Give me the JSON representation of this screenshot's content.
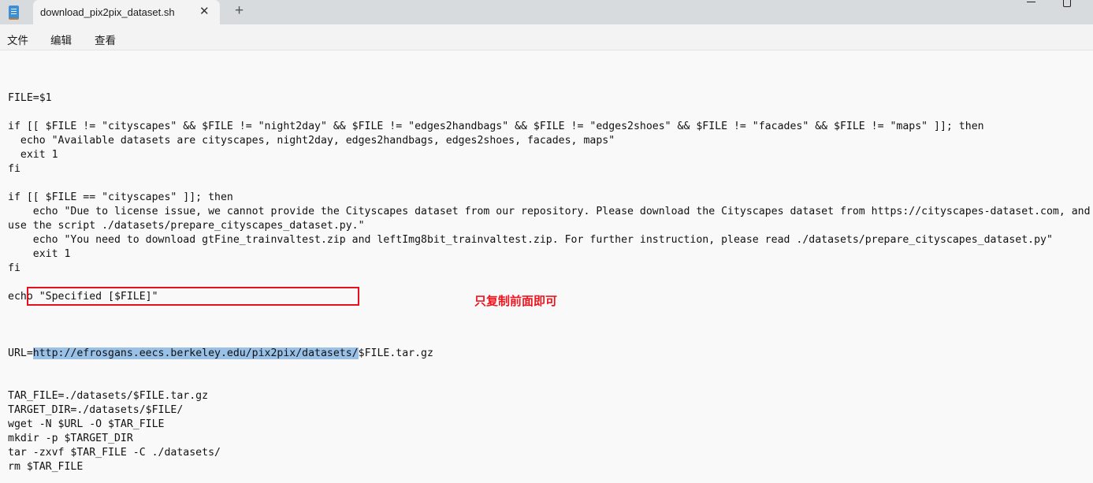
{
  "window": {
    "tab_title": "download_pix2pix_dataset.sh",
    "tab_close_icon": "close-icon",
    "new_tab_icon": "plus-icon",
    "new_tab_symbol": "+",
    "close_symbol": "✕"
  },
  "menu": {
    "items": [
      {
        "label": "文件"
      },
      {
        "label": "编辑"
      },
      {
        "label": "查看"
      }
    ]
  },
  "editor": {
    "lines": [
      "FILE=$1",
      "",
      "if [[ $FILE != \"cityscapes\" && $FILE != \"night2day\" && $FILE != \"edges2handbags\" && $FILE != \"edges2shoes\" && $FILE != \"facades\" && $FILE != \"maps\" ]]; then",
      "  echo \"Available datasets are cityscapes, night2day, edges2handbags, edges2shoes, facades, maps\"",
      "  exit 1",
      "fi",
      "",
      "if [[ $FILE == \"cityscapes\" ]]; then",
      "    echo \"Due to license issue, we cannot provide the Cityscapes dataset from our repository. Please download the Cityscapes dataset from https://cityscapes-dataset.com, and",
      "use the script ./datasets/prepare_cityscapes_dataset.py.\"",
      "    echo \"You need to download gtFine_trainvaltest.zip and leftImg8bit_trainvaltest.zip. For further instruction, please read ./datasets/prepare_cityscapes_dataset.py\"",
      "    exit 1",
      "fi",
      "",
      "echo \"Specified [$FILE]\"",
      ""
    ],
    "url_line": {
      "prefix": "URL=",
      "selected": "http://efrosgans.eecs.berkeley.edu/pix2pix/datasets/",
      "suffix": "$FILE.tar.gz"
    },
    "lines_after": [
      "TAR_FILE=./datasets/$FILE.tar.gz",
      "TARGET_DIR=./datasets/$FILE/",
      "wget -N $URL -O $TAR_FILE",
      "mkdir -p $TARGET_DIR",
      "tar -zxvf $TAR_FILE -C ./datasets/",
      "rm $TAR_FILE"
    ]
  },
  "annotation": {
    "text": "只复制前面即可",
    "color": "#f0141e"
  },
  "colors": {
    "selection": "#99c1e8",
    "box": "#e8101c"
  }
}
